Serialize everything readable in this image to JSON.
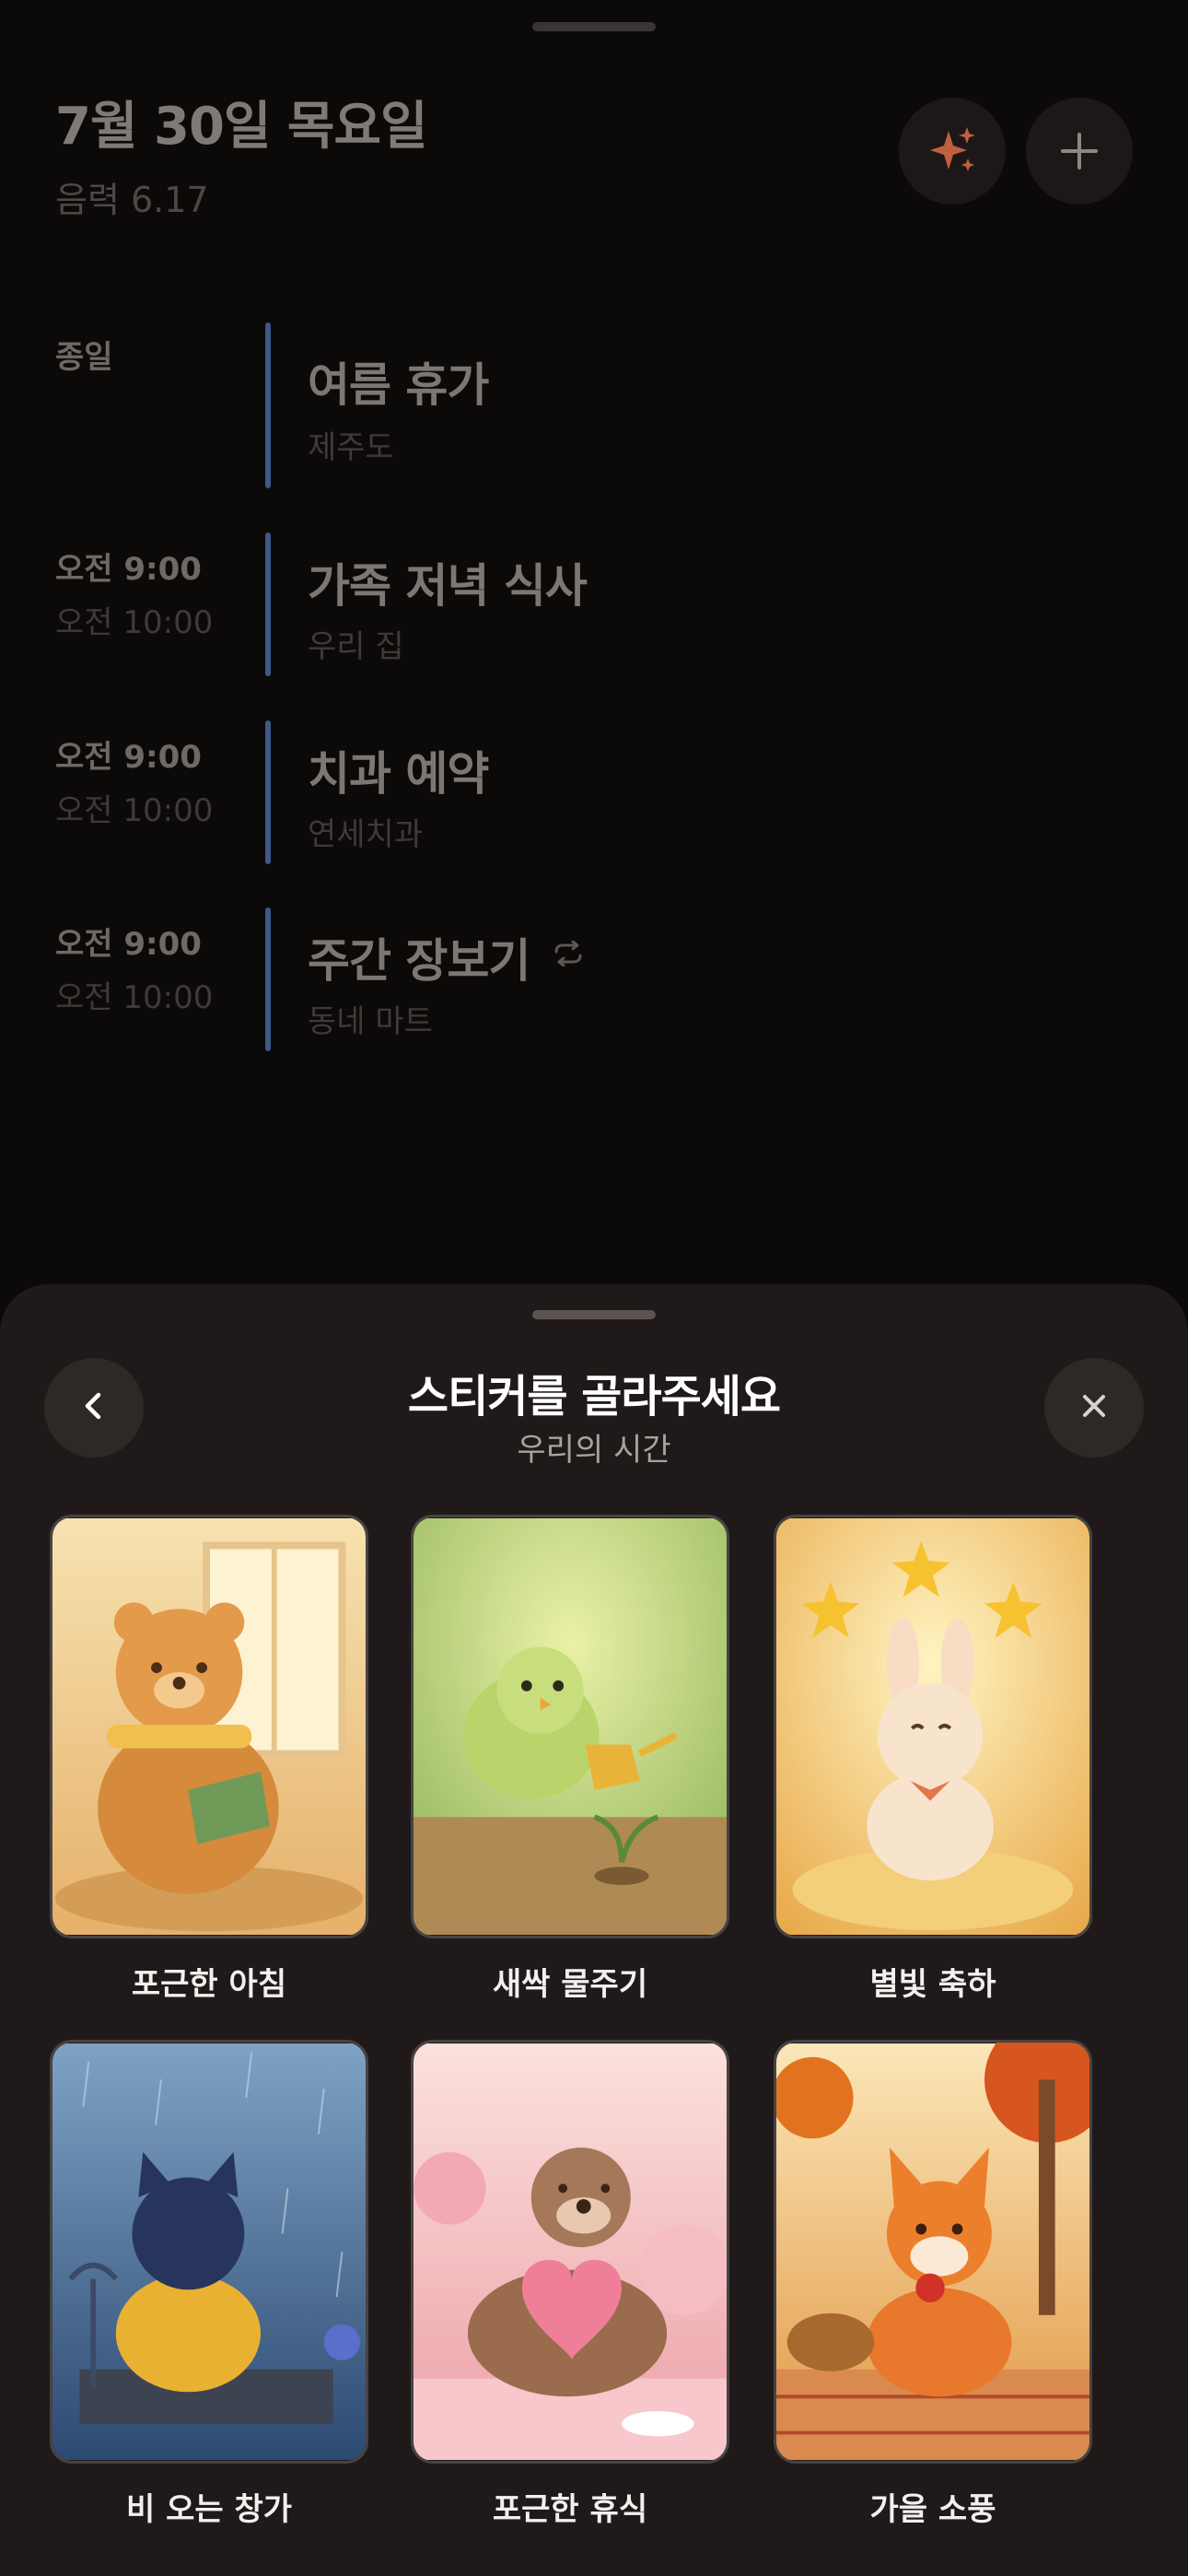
{
  "header": {
    "date": "7월 30일 목요일",
    "lunar": "음력 6.17",
    "sparkle_icon": "sparkle-icon",
    "add_icon": "plus-icon"
  },
  "events": [
    {
      "time_start": "종일",
      "time_end": "",
      "title": "여름 휴가",
      "location": "제주도",
      "repeat": false
    },
    {
      "time_start": "오전 9:00",
      "time_end": "오전 10:00",
      "title": "가족 저녁 식사",
      "location": "우리 집",
      "repeat": false
    },
    {
      "time_start": "오전 9:00",
      "time_end": "오전 10:00",
      "title": "치과 예약",
      "location": "연세치과",
      "repeat": false
    },
    {
      "time_start": "오전 9:00",
      "time_end": "오전 10:00",
      "title": "주간 장보기",
      "location": "동네 마트",
      "repeat": true
    }
  ],
  "sheet": {
    "title": "스티커를 골라주세요",
    "subtitle": "우리의 시간",
    "back_icon": "chevron-left-icon",
    "close_icon": "close-icon",
    "stickers": [
      {
        "label": "포근한 아침",
        "icon": "bear-reading-sticker"
      },
      {
        "label": "새싹 물주기",
        "icon": "bird-watering-sticker"
      },
      {
        "label": "별빛 축하",
        "icon": "bunny-stars-sticker"
      },
      {
        "label": "비 오는 창가",
        "icon": "cat-rain-sticker"
      },
      {
        "label": "포근한 휴식",
        "icon": "otter-rest-sticker"
      },
      {
        "label": "가을 소풍",
        "icon": "fox-picnic-sticker"
      }
    ]
  },
  "colors": {
    "background": "#0c0909",
    "sheet": "#1f1a19",
    "event_bar": "#3c5a87",
    "sparkle": "#c0603f"
  }
}
